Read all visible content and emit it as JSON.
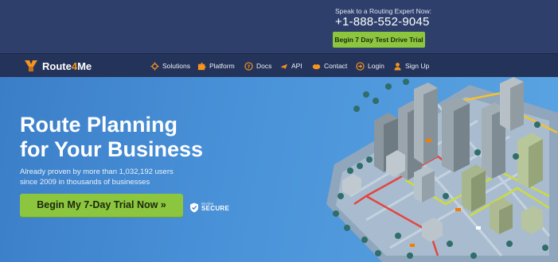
{
  "topbar": {
    "speak_label": "Speak to a Routing Expert Now:",
    "phone": "+1-888-552-9045",
    "trial_button": "Begin 7 Day Test Drive Trial"
  },
  "logo": {
    "brand_part1": "Route",
    "brand_part2": "4",
    "brand_part3": "Me"
  },
  "nav": {
    "items": [
      {
        "label": "Solutions",
        "icon": "gear-icon"
      },
      {
        "label": "Platform",
        "icon": "puzzle-icon"
      },
      {
        "label": "Docs",
        "icon": "question-icon"
      },
      {
        "label": "API",
        "icon": "plane-icon"
      },
      {
        "label": "Contact",
        "icon": "handshake-icon"
      },
      {
        "label": "Login",
        "icon": "login-icon"
      },
      {
        "label": "Sign Up",
        "icon": "user-icon"
      }
    ]
  },
  "hero": {
    "headline_line1": "Route Planning",
    "headline_line2": "for Your Business",
    "subline_line1": "Already proven by more than 1,032,192 users",
    "subline_line2": "since 2009 in thousands of businesses",
    "cta_button": "Begin My 7-Day Trial Now »",
    "badge_small": "McAfee",
    "badge_large": "SECURE"
  },
  "colors": {
    "topbar_bg": "#2e3f6b",
    "navbar_bg": "#24335a",
    "accent_green": "#8cc63f",
    "logo_orange": "#f7941e",
    "hero_blue": "#3b7ec8"
  }
}
